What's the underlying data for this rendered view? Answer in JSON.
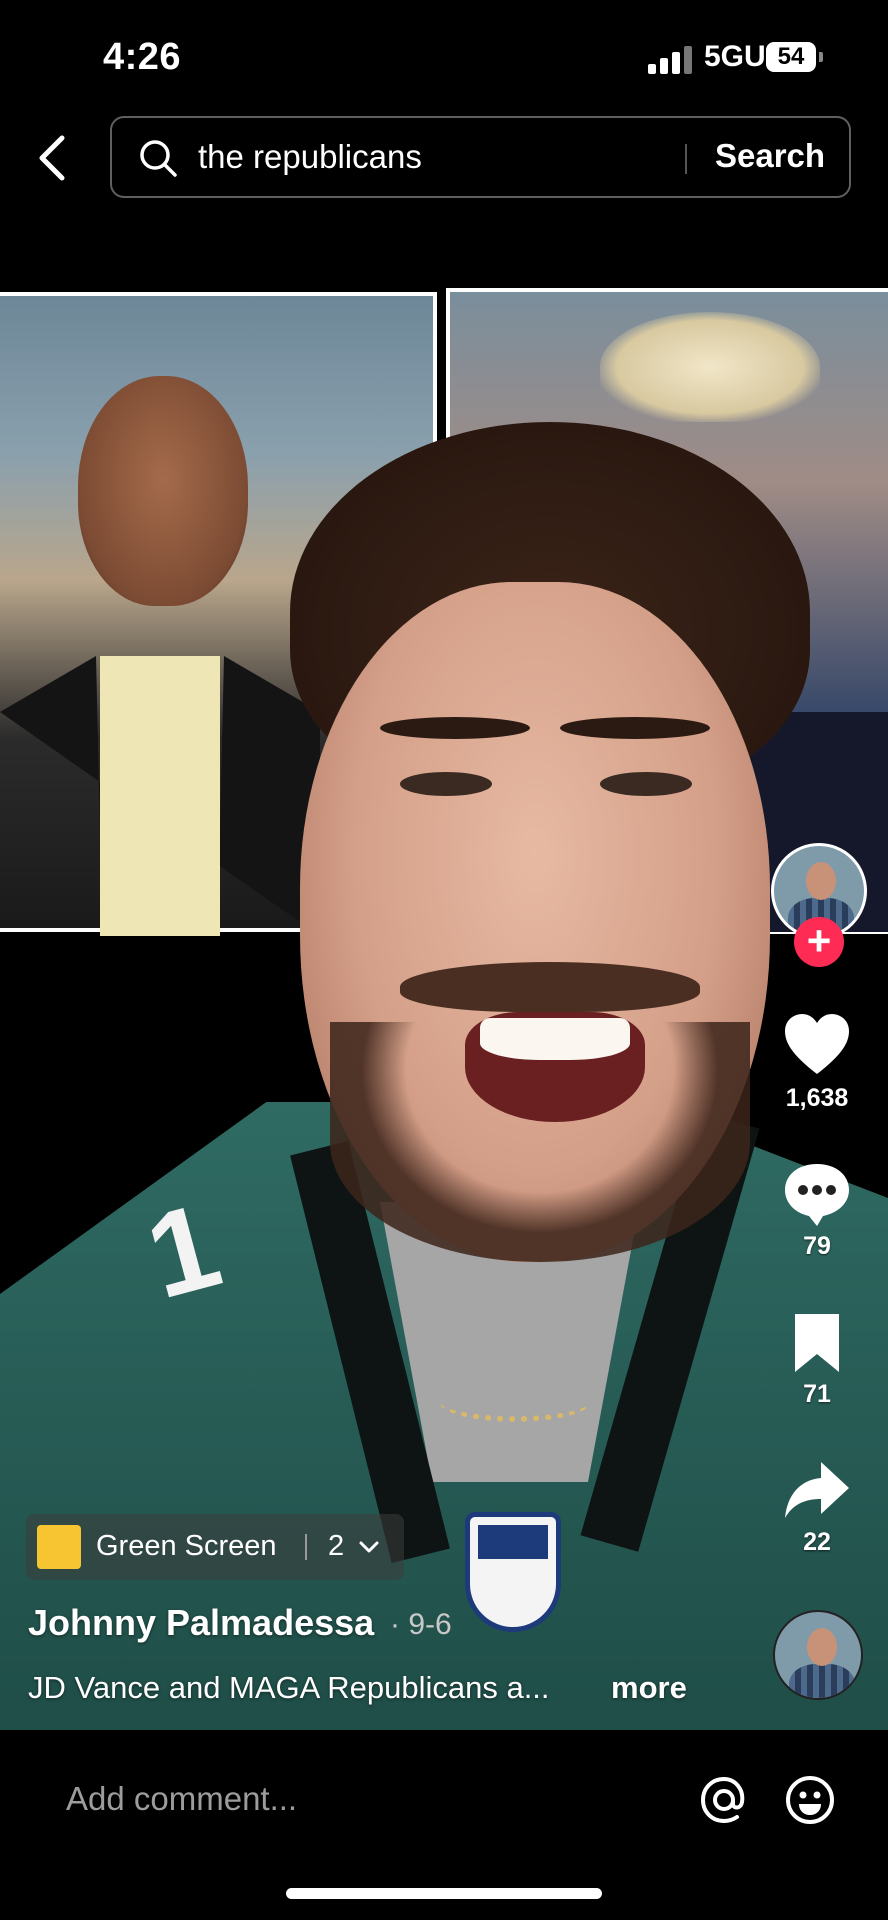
{
  "status_bar": {
    "time": "4:26",
    "network": "5GUC",
    "battery": "54"
  },
  "search": {
    "query": "the republicans",
    "button_label": "Search"
  },
  "video": {
    "effect": {
      "label": "Green Screen",
      "count": "2"
    },
    "author": "Johnny Palmadessa",
    "date": "· 9-6",
    "caption": "JD Vance and MAGA Republicans a...",
    "more_label": "more",
    "jersey_number": "1"
  },
  "actions": {
    "likes": "1,638",
    "comments": "79",
    "saves": "71",
    "shares": "22",
    "follow_symbol": "+"
  },
  "comment_bar": {
    "placeholder": "Add comment..."
  },
  "colors": {
    "follow": "#fe2c55",
    "effect_icon": "#f7c531",
    "jersey": "#2f6b63"
  },
  "icons": {
    "back": "chevron-left-icon",
    "search": "magnifier-icon",
    "like": "heart-icon",
    "comment": "comment-bubble-icon",
    "save": "bookmark-icon",
    "share": "share-arrow-icon",
    "mention": "at-icon",
    "emoji": "emoji-icon"
  }
}
